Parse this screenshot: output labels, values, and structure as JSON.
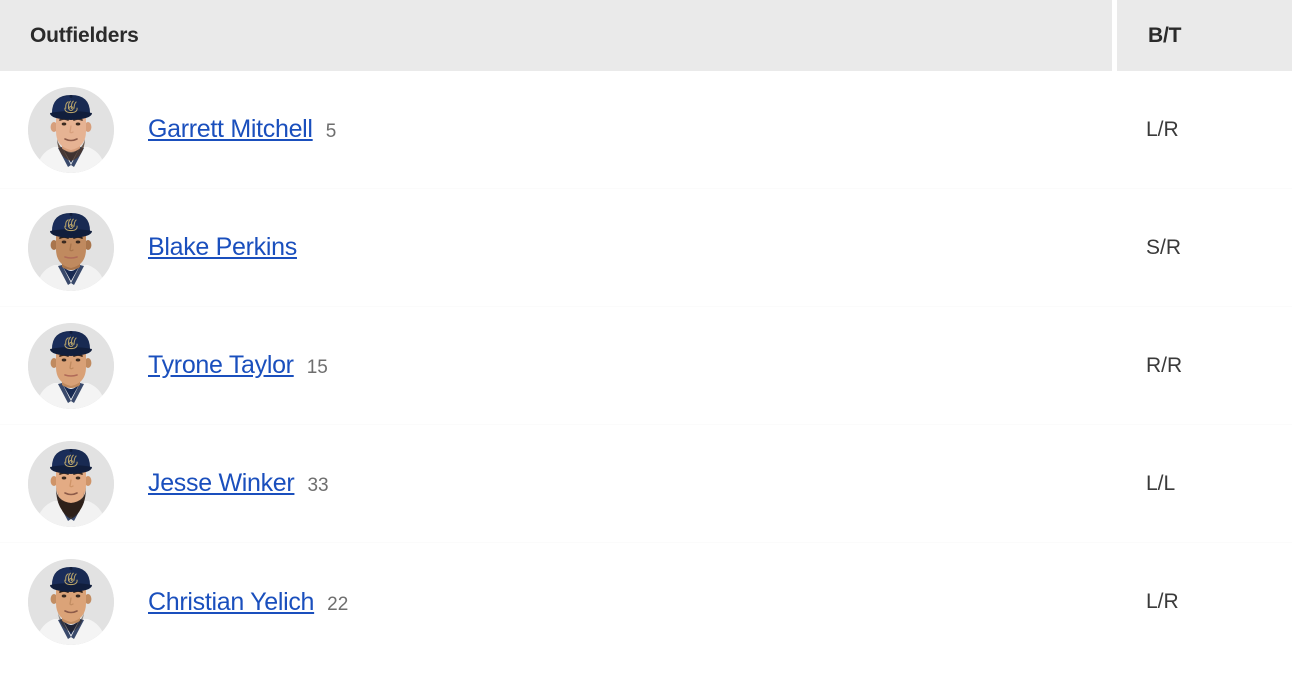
{
  "header": {
    "name_column_label": "Outfielders",
    "bt_column_label": "B/T"
  },
  "colors": {
    "header_background": "#eaeaea",
    "header_text": "#2b2b2b",
    "link_blue": "#1a4fbd",
    "number_gray": "#6e6e6e",
    "bt_text": "#3a3a3a",
    "avatar_background": "#e2e2e2",
    "cap_navy": "#182a52",
    "cap_logo_gold": "#b6a269",
    "row_divider": "#fbfbfb",
    "page_background": "#ffffff"
  },
  "players": [
    {
      "name": "Garrett Mitchell",
      "number": "5",
      "bat_throw": "L/R",
      "avatar": "headshot-garrett-mitchell",
      "skin": "#e6b393",
      "skin_shadow": "#d79f7c",
      "hair": "#4a3528",
      "facial_hair": "#4a3528",
      "has_beard": true,
      "beard_style": "short",
      "jersey": "#f4f4f4"
    },
    {
      "name": "Blake Perkins",
      "number": "",
      "bat_throw": "S/R",
      "avatar": "headshot-blake-perkins",
      "skin": "#c08a5f",
      "skin_shadow": "#a9754c",
      "hair": "#2a1d15",
      "facial_hair": "#2a1d15",
      "has_beard": false,
      "beard_style": "none",
      "jersey": "#f2f2f2"
    },
    {
      "name": "Tyrone Taylor",
      "number": "15",
      "bat_throw": "R/R",
      "avatar": "headshot-tyrone-taylor",
      "skin": "#d9a177",
      "skin_shadow": "#c08a5f",
      "hair": "#33231a",
      "facial_hair": "#33231a",
      "has_beard": false,
      "beard_style": "none",
      "jersey": "#f4f4f4"
    },
    {
      "name": "Jesse Winker",
      "number": "33",
      "bat_throw": "L/L",
      "avatar": "headshot-jesse-winker",
      "skin": "#e3ab84",
      "skin_shadow": "#cf9468",
      "hair": "#3a2a1e",
      "facial_hair": "#2e2019",
      "has_beard": true,
      "beard_style": "full",
      "jersey": "#f2f2f2"
    },
    {
      "name": "Christian Yelich",
      "number": "22",
      "bat_throw": "L/R",
      "avatar": "headshot-christian-yelich",
      "skin": "#dba378",
      "skin_shadow": "#c28d62",
      "hair": "#2b1d14",
      "facial_hair": "#2b1d14",
      "has_beard": true,
      "beard_style": "stubble",
      "jersey": "#f4f4f4"
    }
  ]
}
